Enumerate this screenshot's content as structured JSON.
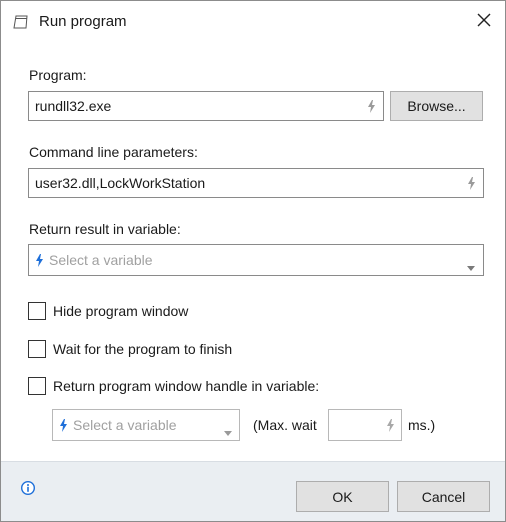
{
  "window": {
    "title": "Run program",
    "title_icon": "window-icon",
    "close_icon": "close-icon"
  },
  "program": {
    "label": "Program:",
    "value": "rundll32.exe",
    "browse_label": "Browse..."
  },
  "params": {
    "label": "Command line parameters:",
    "value": "user32.dll,LockWorkStation"
  },
  "result": {
    "label": "Return result in variable:",
    "placeholder": "Select a variable"
  },
  "options": {
    "hide_window": {
      "label": "Hide program window",
      "checked": false
    },
    "wait_finish": {
      "label": "Wait for the program to finish",
      "checked": false
    },
    "return_handle": {
      "label": "Return program window handle in variable:",
      "checked": false
    }
  },
  "handle": {
    "placeholder": "Select a variable",
    "max_wait_prefix": "(Max. wait",
    "max_wait_value": "",
    "max_wait_suffix": "ms.)"
  },
  "footer": {
    "info_icon": "info-icon",
    "ok_label": "OK",
    "cancel_label": "Cancel"
  },
  "colors": {
    "accent": "#1e6fd9",
    "footer_bg": "#eaeef2",
    "button_bg": "#e1e1e1"
  }
}
